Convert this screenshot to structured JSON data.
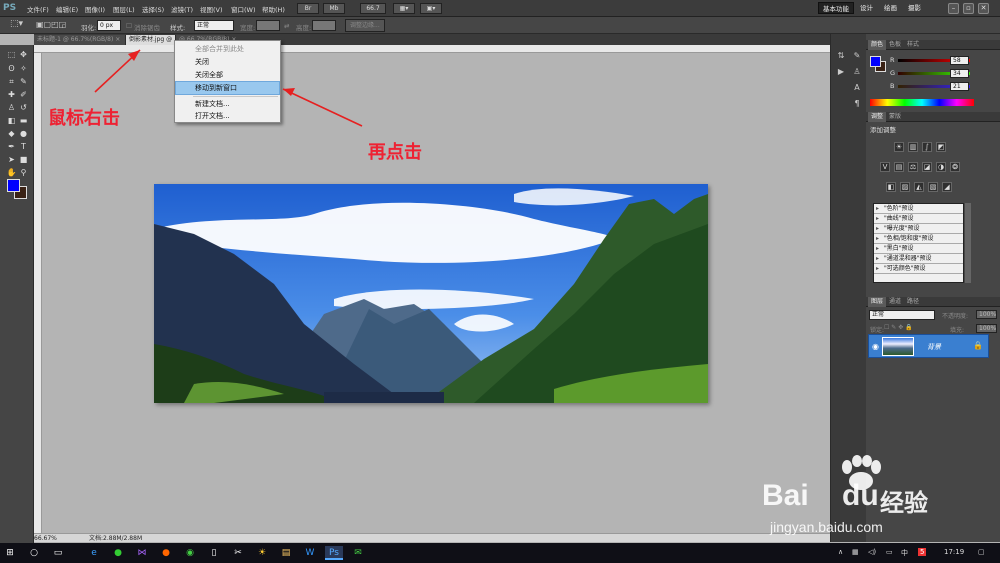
{
  "app": {
    "logo": "PS"
  },
  "menu": {
    "items": [
      "文件(F)",
      "编辑(E)",
      "图像(I)",
      "图层(L)",
      "选择(S)",
      "滤镜(T)",
      "视图(V)",
      "窗口(W)",
      "帮助(H)"
    ],
    "zoom_value": "66.7"
  },
  "workspaces": {
    "active": "基本功能",
    "items": [
      "设计",
      "绘画",
      "摄影"
    ]
  },
  "window_buttons": {
    "minimize": "–",
    "restore": "▫",
    "close": "✕"
  },
  "options": {
    "feather_label": "羽化:",
    "feather_value": "0 px",
    "antialias_label": "消除锯齿",
    "style_label": "样式:",
    "style_value": "正常",
    "width_label": "宽度:",
    "height_label": "高度:",
    "refine_edge": "调整边缘..."
  },
  "doc_tabs": [
    {
      "label": "未标题-1 @ 66.7%(RGB/8) ×",
      "active": false
    },
    {
      "label": "倒影素材.jpg @",
      "active": true
    },
    {
      "label": "@ 66.7%(RGB/8) ×",
      "active": false
    }
  ],
  "context_menu": {
    "items": [
      {
        "label": "全部合并到此处",
        "disabled": true
      },
      {
        "label": "关闭"
      },
      {
        "label": "关闭全部"
      },
      {
        "label": "移动到新窗口",
        "highlighted": true
      },
      {
        "label": "新建文档..."
      },
      {
        "label": "打开文档..."
      }
    ]
  },
  "annotations": {
    "right_click": "鼠标右击",
    "then_click": "再点击"
  },
  "status": {
    "zoom": "66.67%",
    "doc_size": "文档:2.88M/2.88M"
  },
  "color_panel": {
    "tabs": [
      "颜色",
      "色板",
      "样式"
    ],
    "r_label": "R",
    "r": "58",
    "g_label": "G",
    "g": "34",
    "b_label": "B",
    "b": "21",
    "foreground": "#0000ff",
    "background": "#3a2215"
  },
  "adjustments_panel": {
    "tabs": [
      "调整",
      "蒙版"
    ],
    "title": "添加调整",
    "presets": [
      "\"色阶\"预设",
      "\"曲线\"预设",
      "\"曝光度\"预设",
      "\"色相/饱和度\"预设",
      "\"黑白\"预设",
      "\"通道混和器\"预设",
      "\"可选颜色\"预设"
    ]
  },
  "layers_panel": {
    "tabs": [
      "图层",
      "通道",
      "路径"
    ],
    "blend_mode": "正常",
    "opacity_label": "不透明度:",
    "opacity": "100%",
    "lock_label": "锁定:",
    "fill_label": "填充:",
    "fill": "100%",
    "layer_name": "背景"
  },
  "taskbar": {
    "time": "17:19",
    "lang": "中",
    "badge": "5"
  },
  "watermark": {
    "brand_a": "Bai",
    "brand_b": "du",
    "brand_cn": "经验",
    "url": "jingyan.baidu.com"
  }
}
